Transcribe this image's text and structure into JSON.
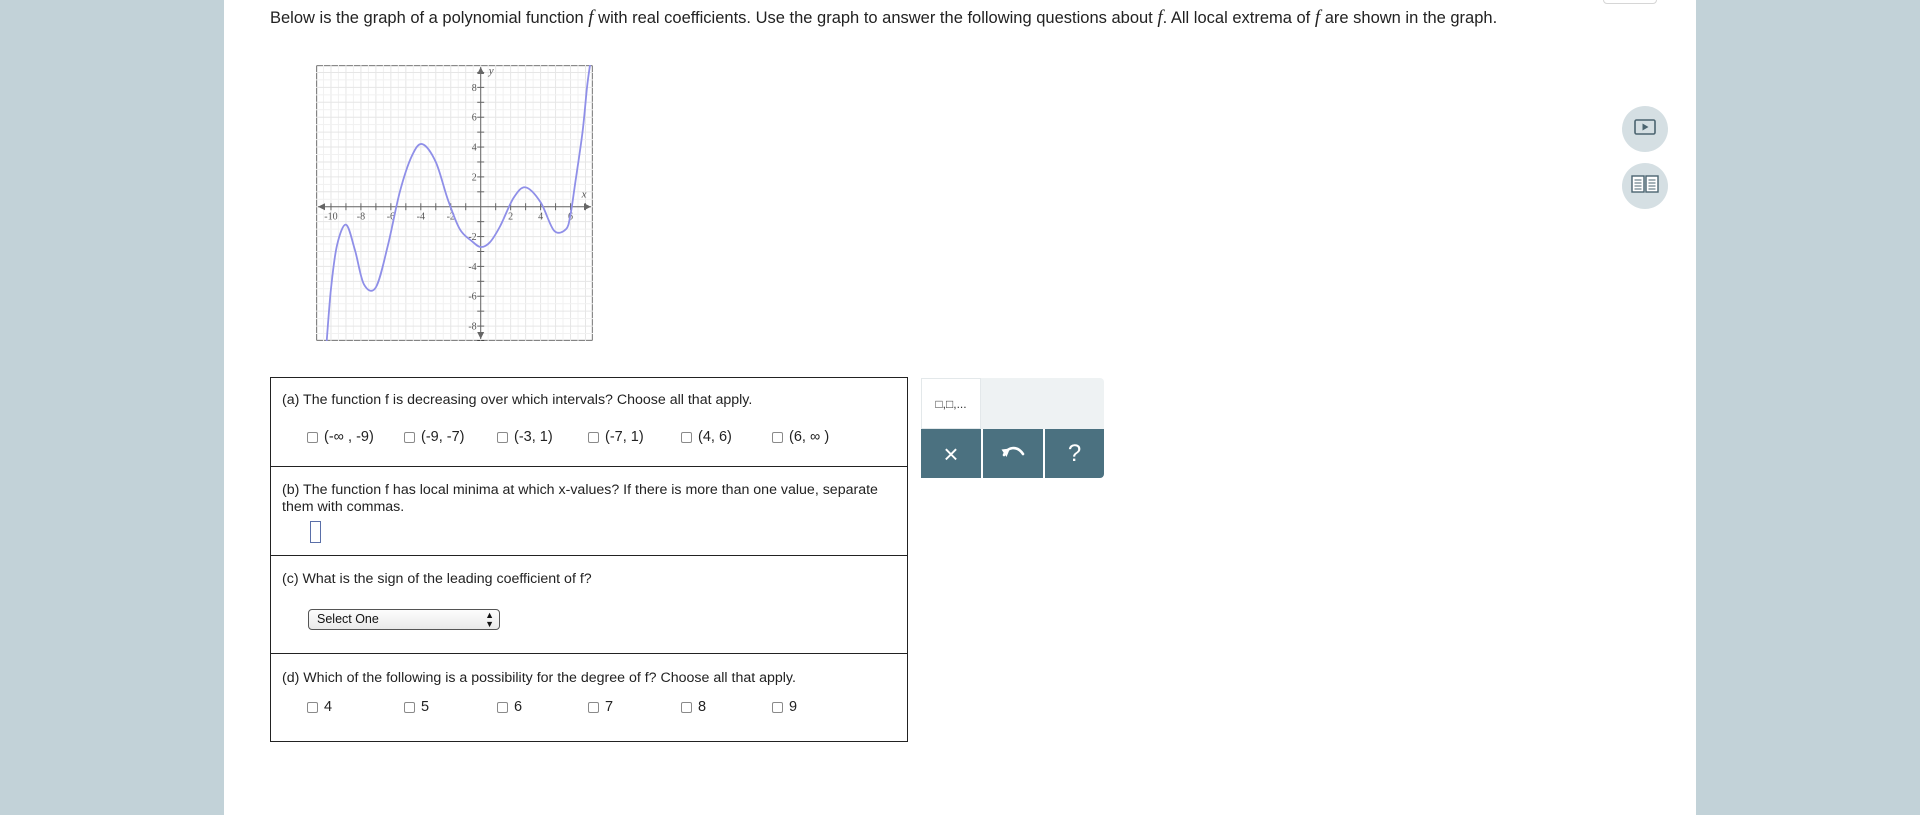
{
  "intro": {
    "part1": "Below is the graph of a polynomial function ",
    "f1": "f",
    "part2": " with real coefficients. Use the graph to answer the following questions about ",
    "f2": "f",
    "part3": ". All local extrema of ",
    "f3": "f",
    "part4": " are shown in the graph."
  },
  "graph": {
    "x_axis_label": "x",
    "y_axis_label": "y",
    "x_tick_labels": [
      "-10",
      "-8",
      "-6",
      "-4",
      "-2",
      "2",
      "4",
      "6"
    ],
    "y_tick_labels": [
      "8",
      "6",
      "4",
      "2",
      "-2",
      "-4",
      "-6",
      "-8"
    ],
    "curve_color": "#8f8fe8"
  },
  "chart_data": {
    "type": "line",
    "xlim": [
      -11,
      7.5
    ],
    "ylim": [
      -9,
      9.5
    ],
    "grid": true,
    "series": [
      {
        "x": [
          -10.3,
          -10.0,
          -9.6,
          -9.0,
          -8.4,
          -7.8,
          -7.0,
          -6.2,
          -5.4,
          -4.6,
          -3.9,
          -3.0,
          -2.2,
          -1.4,
          -0.6,
          0.0,
          0.6,
          1.3,
          2.2,
          3.0,
          4.0,
          4.9,
          5.7,
          6.0,
          6.3,
          6.8,
          7.1,
          7.3
        ],
        "y": [
          -9.2,
          -5.5,
          -2.6,
          -1.2,
          -2.9,
          -5.2,
          -5.4,
          -2.6,
          1.0,
          3.4,
          4.2,
          3.0,
          0.5,
          -1.5,
          -2.3,
          -2.7,
          -2.4,
          -1.3,
          0.6,
          1.3,
          0.3,
          -1.6,
          -1.5,
          -0.5,
          1.5,
          5.0,
          8.0,
          9.5
        ]
      }
    ]
  },
  "questions": {
    "a": {
      "text": "(a) The function f is decreasing over which intervals? Choose all that apply.",
      "options": [
        "(-∞ , -9)",
        "(-9, -7)",
        "(-3, 1)",
        "(-7, 1)",
        "(4, 6)",
        "(6, ∞ )"
      ]
    },
    "b": {
      "text": "(b) The function f has local minima at which x-values? If there is more than one value, separate them with commas."
    },
    "c": {
      "text": "(c) What is the sign of the leading coefficient of f?",
      "select_value": "Select One"
    },
    "d": {
      "text": "(d) Which of the following is a possibility for the degree of f? Choose all that apply.",
      "options": [
        "4",
        "5",
        "6",
        "7",
        "8",
        "9"
      ]
    }
  },
  "toolbar": {
    "template_label": "□,□,...",
    "clear_icon": "×",
    "undo_icon": "undo-arrow",
    "help_label": "?"
  },
  "side_buttons": [
    "play-icon",
    "book-icon"
  ]
}
